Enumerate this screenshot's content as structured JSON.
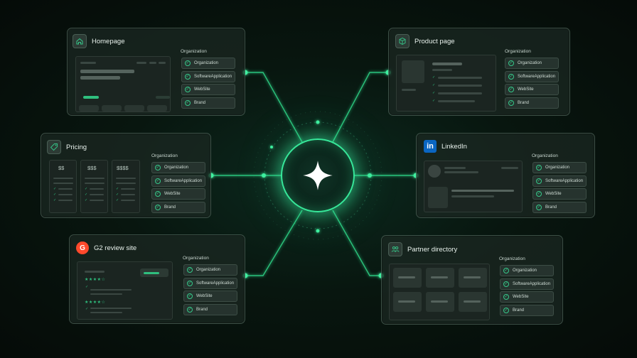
{
  "hub": {
    "icon": "sparkle-icon"
  },
  "cards": {
    "homepage": {
      "title": "Homepage",
      "icon": "home-icon",
      "org_heading": "Organization",
      "schemas": [
        "Organization",
        "SoftwareApplication",
        "WebSite",
        "Brand"
      ]
    },
    "product": {
      "title": "Product page",
      "icon": "cube-icon",
      "org_heading": "Organization",
      "schemas": [
        "Organization",
        "SoftwareApplication",
        "WebSite",
        "Brand"
      ]
    },
    "pricing": {
      "title": "Pricing",
      "icon": "tag-icon",
      "org_heading": "Organization",
      "prices": [
        "$$",
        "$$$",
        "$$$$"
      ],
      "schemas": [
        "Organization",
        "SoftwareApplication",
        "WebSite",
        "Brand"
      ]
    },
    "linkedin": {
      "title": "LinkedIn",
      "icon": "linkedin-icon",
      "logo_text": "in",
      "org_heading": "Organization",
      "schemas": [
        "Organization",
        "SoftwareApplication",
        "WebSite",
        "Brand"
      ]
    },
    "g2": {
      "title": "G2 review site",
      "icon": "g2-logo-icon",
      "logo_text": "G",
      "org_heading": "Organization",
      "schemas": [
        "Organization",
        "SoftwareApplication",
        "WebSite",
        "Brand"
      ]
    },
    "partner": {
      "title": "Partner directory",
      "icon": "people-icon",
      "org_heading": "Organization",
      "schemas": [
        "Organization",
        "SoftwareApplication",
        "WebSite",
        "Brand"
      ]
    }
  },
  "colors": {
    "accent": "#37e89a",
    "check": "#35c98a",
    "background": "#08160f",
    "g2_red": "#ff492c",
    "linkedin_blue": "#0a66c2"
  }
}
